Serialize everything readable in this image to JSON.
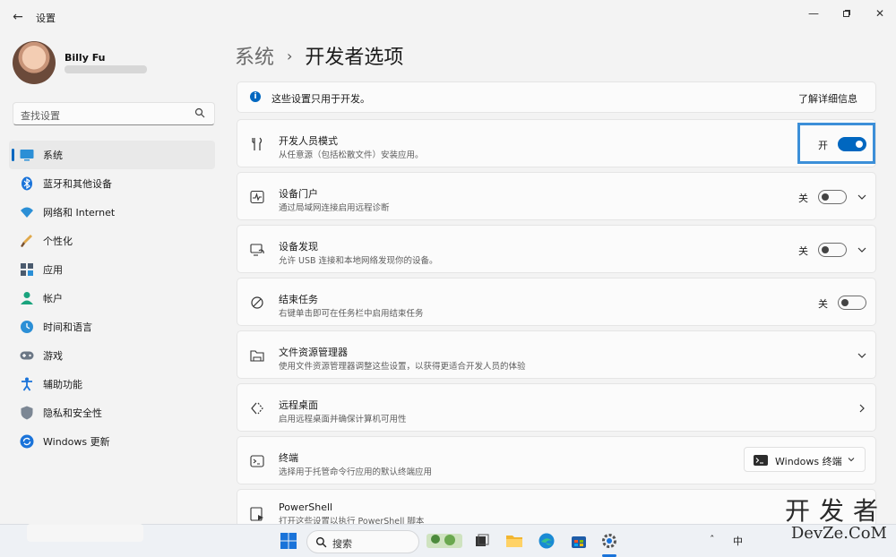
{
  "window": {
    "title": "设置",
    "back_icon": "back-arrow-icon",
    "controls": [
      "minimize-icon",
      "maximize-icon",
      "close-icon"
    ]
  },
  "profile": {
    "name": "Billy Fu"
  },
  "search": {
    "placeholder": "查找设置"
  },
  "sidebar": {
    "items": [
      {
        "label": "系统",
        "icon": "system-icon",
        "active": true
      },
      {
        "label": "蓝牙和其他设备",
        "icon": "bluetooth-icon"
      },
      {
        "label": "网络和 Internet",
        "icon": "network-icon"
      },
      {
        "label": "个性化",
        "icon": "personalization-icon"
      },
      {
        "label": "应用",
        "icon": "apps-icon"
      },
      {
        "label": "帐户",
        "icon": "accounts-icon"
      },
      {
        "label": "时间和语言",
        "icon": "time-language-icon"
      },
      {
        "label": "游戏",
        "icon": "gaming-icon"
      },
      {
        "label": "辅助功能",
        "icon": "accessibility-icon"
      },
      {
        "label": "隐私和安全性",
        "icon": "privacy-icon"
      },
      {
        "label": "Windows 更新",
        "icon": "windows-update-icon"
      }
    ]
  },
  "breadcrumb": {
    "parent": "系统",
    "current": "开发者选项"
  },
  "info": {
    "text": "这些设置只用于开发。",
    "link": "了解详细信息"
  },
  "settings": [
    {
      "title": "开发人员模式",
      "desc": "从任意源（包括松散文件）安装应用。",
      "state": "开",
      "toggle": true
    },
    {
      "title": "设备门户",
      "desc": "通过局域网连接启用远程诊断",
      "state": "关",
      "toggle": false,
      "expand": true
    },
    {
      "title": "设备发现",
      "desc": "允许 USB 连接和本地网络发现你的设备。",
      "state": "关",
      "toggle": false,
      "expand": true
    },
    {
      "title": "结束任务",
      "desc": "右键单击即可在任务栏中启用结束任务",
      "state": "关",
      "toggle": false
    },
    {
      "title": "文件资源管理器",
      "desc": "使用文件资源管理器调整这些设置，以获得更适合开发人员的体验",
      "expand": true
    },
    {
      "title": "远程桌面",
      "desc": "启用远程桌面并确保计算机可用性",
      "navigate": true
    },
    {
      "title": "终端",
      "desc": "选择用于托管命令行应用的默认终端应用",
      "dropdown": "Windows 终端"
    },
    {
      "title": "PowerShell",
      "desc": "打开这些设置以执行 PowerShell 脚本"
    }
  ],
  "taskbar": {
    "search_label": "搜索",
    "tray_lang": "中"
  },
  "watermark": {
    "cn": "开发者",
    "en": "DevZe.CoM"
  },
  "colors": {
    "accent": "#0067c0",
    "highlight": "#3c8fd8",
    "background": "#f3f3f3",
    "card": "#fbfbfb"
  }
}
